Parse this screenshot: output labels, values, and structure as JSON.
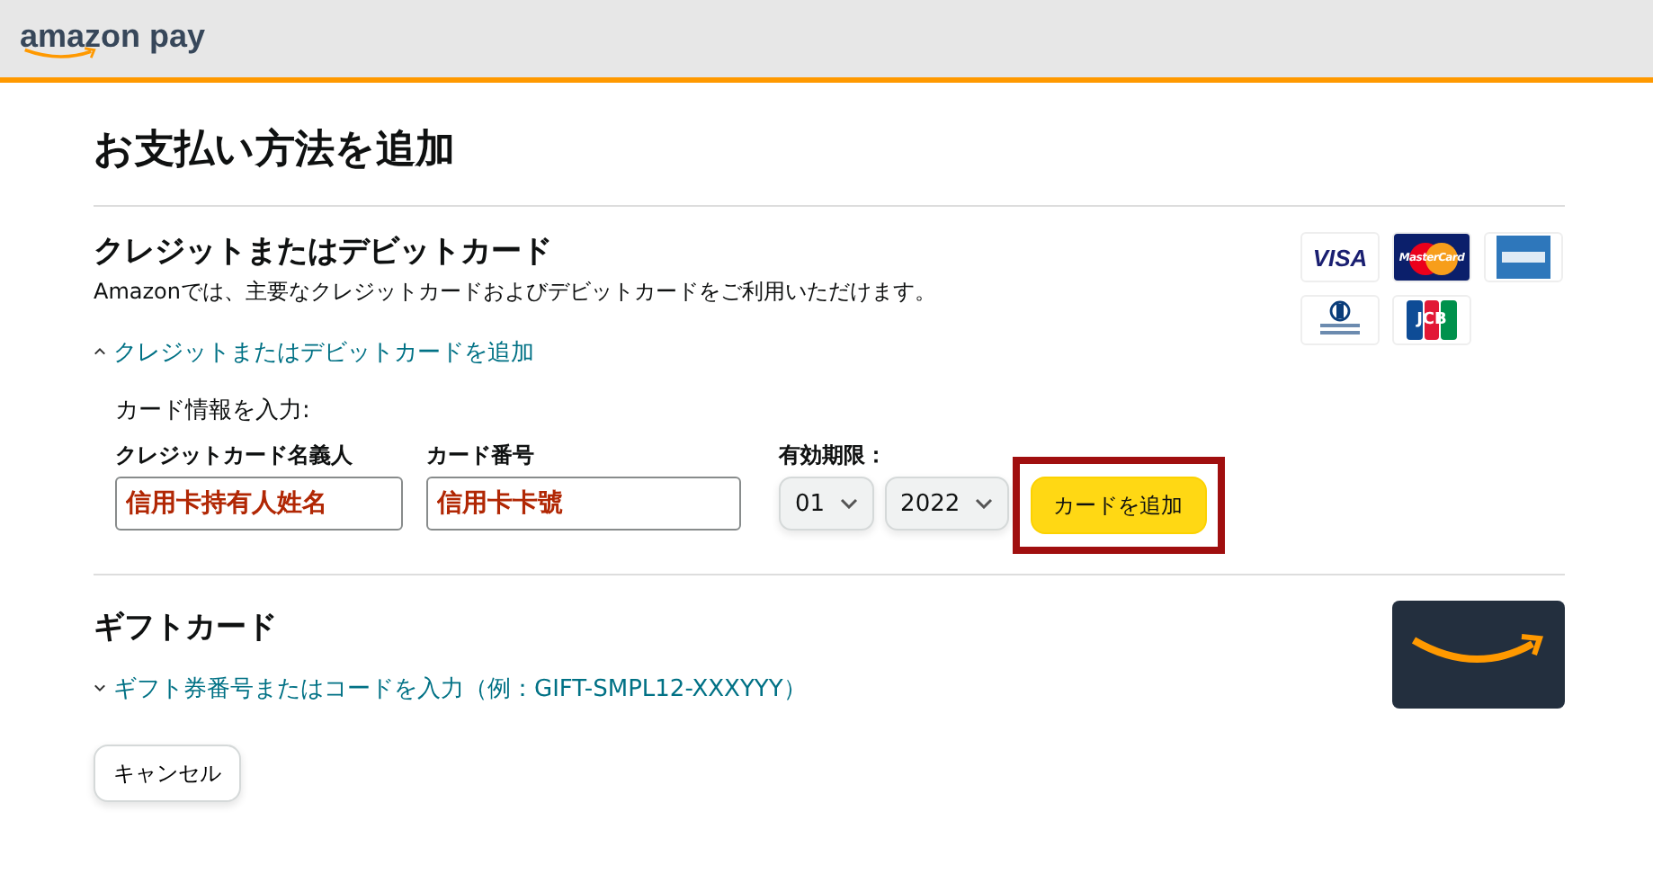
{
  "header": {
    "logo": "amazon pay"
  },
  "title": "お支払い方法を追加",
  "card_section": {
    "heading": "クレジットまたはデビットカード",
    "description": "Amazonでは、主要なクレジットカードおよびデビットカードをご利用いただけます。",
    "toggle": {
      "label": "クレジットまたはデビットカードを追加",
      "expanded": true
    },
    "logos": [
      {
        "kind": "visa",
        "label": "VISA"
      },
      {
        "kind": "mastercard",
        "label": "MasterCard"
      },
      {
        "kind": "amex"
      },
      {
        "kind": "diners"
      },
      {
        "kind": "jcb",
        "label": "JCB"
      }
    ],
    "form": {
      "prompt": "カード情報を入力:",
      "name_label": "クレジットカード名義人",
      "name_value": "信用卡持有人姓名",
      "number_label": "カード番号",
      "number_value": "信用卡卡號",
      "expiry_label": "有効期限：",
      "month": "01",
      "year": "2022",
      "submit": {
        "label": "カードを追加",
        "highlighted": true
      }
    }
  },
  "gift_section": {
    "heading": "ギフトカード",
    "toggle": {
      "label": "ギフト券番号またはコードを入力（例：GIFT-SMPL12-XXXYYY）",
      "expanded": false
    }
  },
  "cancel": "キャンセル"
}
